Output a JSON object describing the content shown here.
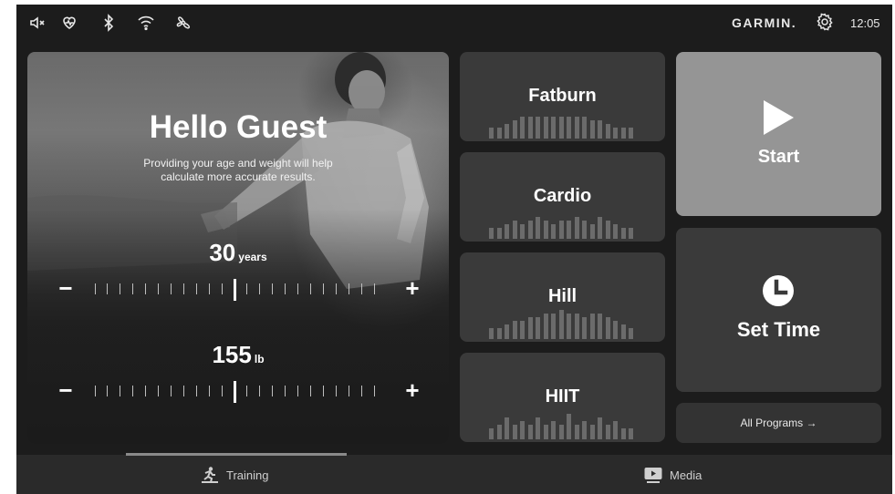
{
  "status_bar": {
    "icons": [
      "mute-icon",
      "heart-rate-icon",
      "bluetooth-icon",
      "wifi-icon",
      "fan-icon"
    ],
    "brand": "GARMIN.",
    "time": "12:05"
  },
  "hero": {
    "title": "Hello Guest",
    "subtitle": "Providing your age and weight will help calculate more accurate results.",
    "age": {
      "value": "30",
      "unit": "years",
      "minus": "−",
      "plus": "+"
    },
    "weight": {
      "value": "155",
      "unit": "lb",
      "minus": "−",
      "plus": "+"
    }
  },
  "programs": [
    {
      "name": "Fatburn",
      "profile": [
        3,
        3,
        4,
        5,
        6,
        6,
        6,
        6,
        6,
        6,
        6,
        6,
        6,
        5,
        5,
        4,
        3,
        3,
        3
      ]
    },
    {
      "name": "Cardio",
      "profile": [
        3,
        3,
        4,
        5,
        4,
        5,
        6,
        5,
        4,
        5,
        5,
        6,
        5,
        4,
        6,
        5,
        4,
        3,
        3
      ]
    },
    {
      "name": "Hill",
      "profile": [
        3,
        3,
        4,
        5,
        5,
        6,
        6,
        7,
        7,
        8,
        7,
        7,
        6,
        7,
        7,
        6,
        5,
        4,
        3
      ]
    },
    {
      "name": "HIIT",
      "profile": [
        3,
        4,
        6,
        4,
        5,
        4,
        6,
        4,
        5,
        4,
        7,
        4,
        5,
        4,
        6,
        4,
        5,
        3,
        3
      ]
    }
  ],
  "start": {
    "label": "Start"
  },
  "set_time": {
    "label": "Set Time"
  },
  "all_programs": {
    "label": "All Programs →"
  },
  "nav": {
    "training": "Training",
    "media": "Media"
  }
}
